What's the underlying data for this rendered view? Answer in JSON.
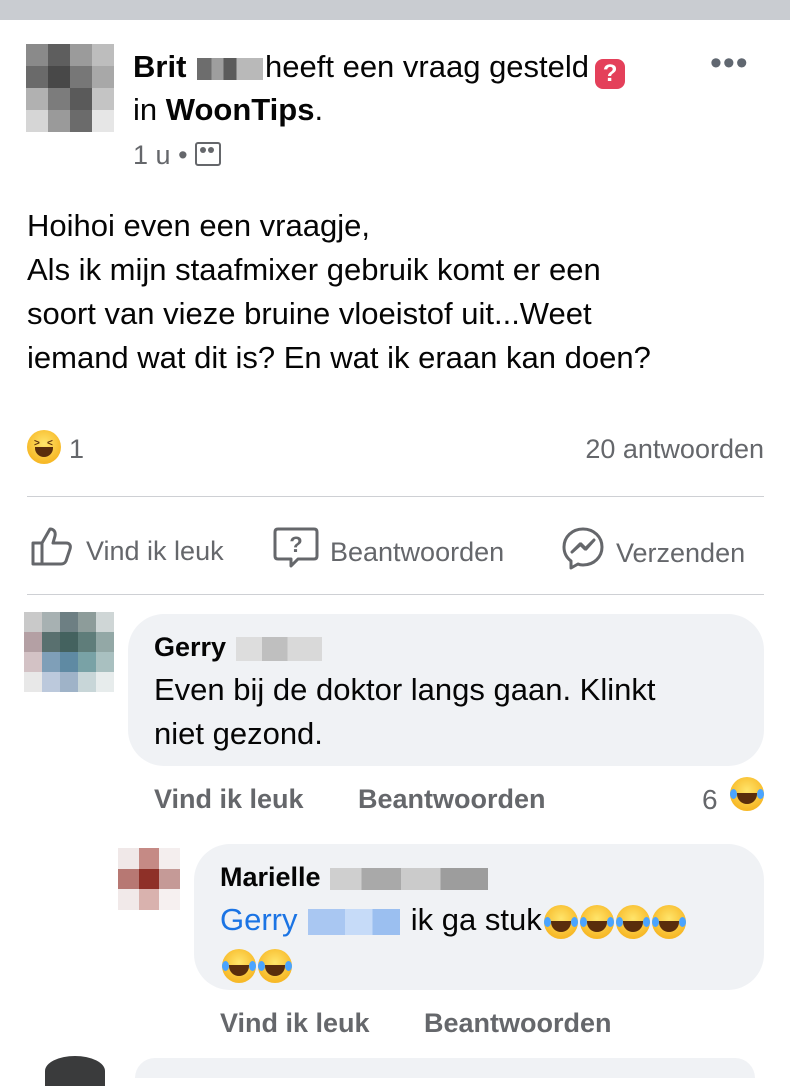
{
  "post": {
    "author_first": "Brit",
    "action_text": "heeft een vraag gesteld",
    "in_label": "in",
    "group": "WoonTips",
    "period": ".",
    "time": "1 u",
    "separator": "•",
    "body_lines": [
      "Hoihoi even een vraagje,",
      "Als ik mijn staafmixer gebruik komt er een",
      "soort van vieze bruine vloeistof uit...Weet",
      "iemand wat dit is? En wat ik eraan kan doen?"
    ],
    "reaction_count": "1",
    "answers_count": "20 antwoorden",
    "actions": {
      "like": "Vind ik leuk",
      "answer": "Beantwoorden",
      "send": "Verzenden"
    }
  },
  "comments": [
    {
      "author": "Gerry",
      "text_lines": [
        "Even bij de doktor langs gaan. Klinkt",
        "niet gezond."
      ],
      "like": "Vind ik leuk",
      "reply": "Beantwoorden",
      "reaction_count": "6"
    },
    {
      "author": "Marielle",
      "tag": "Gerry",
      "text": "ik ga stuk",
      "like": "Vind ik leuk",
      "reply": "Beantwoorden"
    }
  ],
  "colors": {
    "question_badge": "#e4405a",
    "tag_blue": "#1b74e4",
    "bubble": "#f0f2f5",
    "secondary_text": "#65676b"
  },
  "icons": [
    "more-icon",
    "question-badge-icon",
    "group-icon",
    "laughing-emoji",
    "thumbs-up-icon",
    "question-icon",
    "messenger-icon",
    "crying-laughing-emoji"
  ]
}
